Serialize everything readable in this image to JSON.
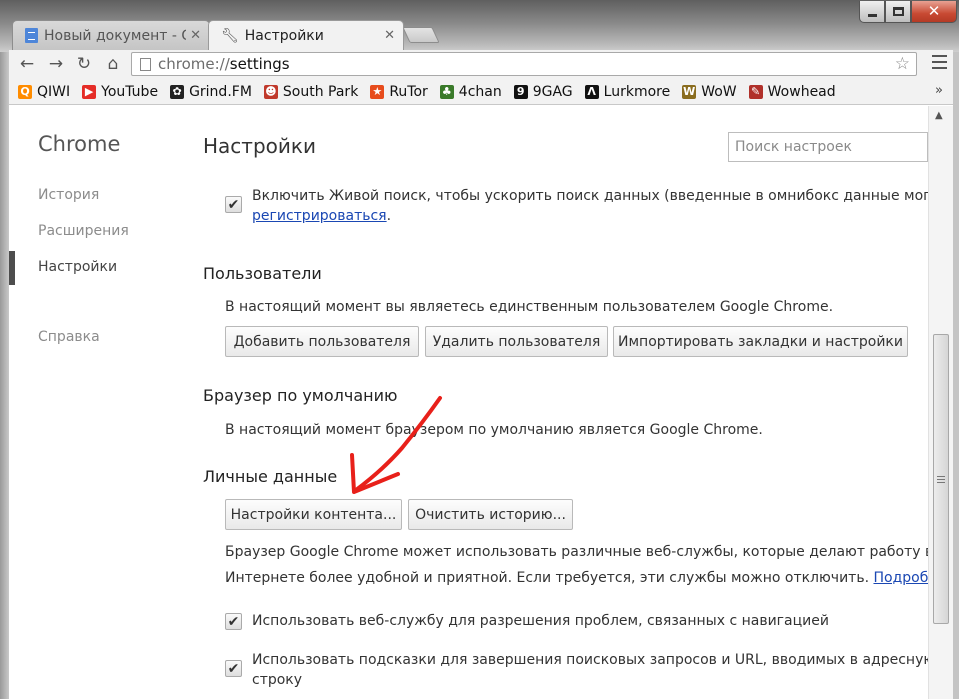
{
  "tabs": [
    {
      "title": "Новый документ - G",
      "close": "✕"
    },
    {
      "title": "Настройки",
      "close": "✕"
    }
  ],
  "window_controls": {
    "close_glyph": "✕"
  },
  "toolbar": {
    "back_glyph": "←",
    "forward_glyph": "→",
    "reload_glyph": "↻",
    "home_glyph": "⌂",
    "url_scheme": "chrome://",
    "url_host": "settings",
    "star_glyph": "☆"
  },
  "bookmarks": [
    {
      "label": "QIWI",
      "icon": "qiwi-icon",
      "color": "#ff8c00",
      "glyph": "Q"
    },
    {
      "label": "YouTube",
      "icon": "youtube-icon",
      "color": "#e52d27",
      "glyph": "▶"
    },
    {
      "label": "Grind.FM",
      "icon": "paw-icon",
      "color": "#222222",
      "glyph": "✿"
    },
    {
      "label": "South Park",
      "icon": "south-park-icon",
      "color": "#c0392b",
      "glyph": "☻"
    },
    {
      "label": "RuTor",
      "icon": "rutor-icon",
      "color": "#e74c1c",
      "glyph": "★"
    },
    {
      "label": "4chan",
      "icon": "clover-icon",
      "color": "#3a7a2a",
      "glyph": "♣"
    },
    {
      "label": "9GAG",
      "icon": "9gag-icon",
      "color": "#111111",
      "glyph": "9"
    },
    {
      "label": "Lurkmore",
      "icon": "lambda-icon",
      "color": "#111111",
      "glyph": "Λ"
    },
    {
      "label": "WoW",
      "icon": "wow-icon",
      "color": "#8a6d1f",
      "glyph": "W"
    },
    {
      "label": "Wowhead",
      "icon": "wowhead-icon",
      "color": "#b0302a",
      "glyph": "✎"
    }
  ],
  "bookmarks_more": "»",
  "sidebar": {
    "brand": "Chrome",
    "items": [
      {
        "label": "История"
      },
      {
        "label": "Расширения"
      },
      {
        "label": "Настройки"
      },
      {
        "label": "Справка"
      }
    ]
  },
  "main": {
    "title": "Настройки",
    "search_placeholder": "Поиск настроек",
    "instant": {
      "check": "✔",
      "line1": "Включить Живой поиск, чтобы ускорить поиск данных (введенные в омнибокс данные могут",
      "link": "регистрироваться",
      "tail": "."
    },
    "users": {
      "heading": "Пользователи",
      "text": "В настоящий момент вы являетесь единственным пользователем Google Chrome.",
      "buttons": [
        "Добавить пользователя",
        "Удалить пользователя",
        "Импортировать закладки и настройки"
      ]
    },
    "default_browser": {
      "heading": "Браузер по умолчанию",
      "text": "В настоящий момент браузером по умолчанию является Google Chrome."
    },
    "privacy": {
      "heading": "Личные данные",
      "buttons": [
        "Настройки контента...",
        "Очистить историю..."
      ],
      "text1": "Браузер Google Chrome может использовать различные веб-службы, которые делают работу в",
      "text2": "Интернете более удобной и приятной. Если требуется, эти службы можно отключить.",
      "more_link": "Подробнее...",
      "check": "✔",
      "opt1": "Использовать веб-службу для разрешения проблем, связанных с навигацией",
      "opt2_line1": "Использовать подсказки для завершения поисковых запросов и URL, вводимых в адресную",
      "opt2_line2": "строку"
    }
  },
  "scrollbar": {
    "up_glyph": "▲"
  },
  "colors": {
    "annotation_arrow": "#e8201a",
    "link": "#1a47b3"
  }
}
